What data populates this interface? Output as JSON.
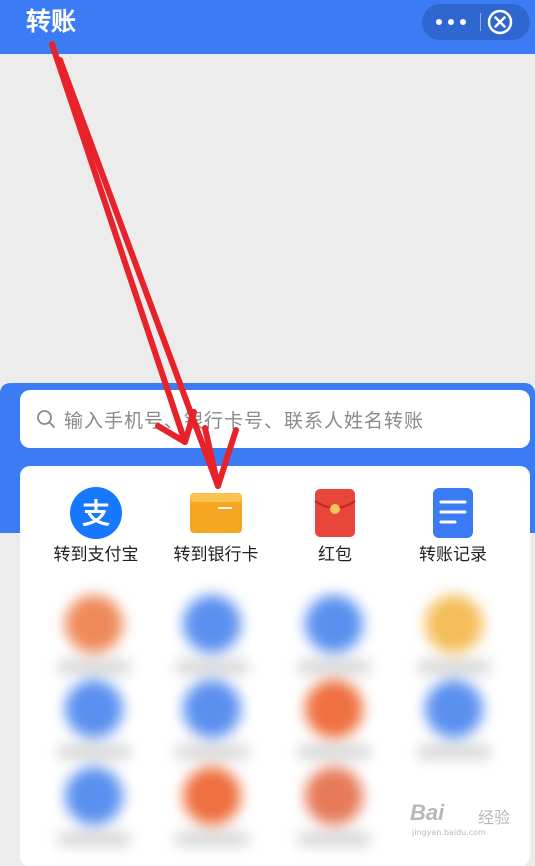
{
  "header": {
    "title": "转账",
    "more_icon": "more-dots-icon",
    "close_icon": "close-circle-icon"
  },
  "search": {
    "placeholder": "输入手机号、银行卡号、联系人姓名转账"
  },
  "features": [
    {
      "label": "转到支付宝",
      "icon": "alipay-icon",
      "color": "#1677ff"
    },
    {
      "label": "转到银行卡",
      "icon": "bank-card-icon",
      "color": "#f6a623"
    },
    {
      "label": "红包",
      "icon": "red-envelope-icon",
      "color": "#e8463a"
    },
    {
      "label": "转账记录",
      "icon": "record-icon",
      "color": "#3b7cf4"
    }
  ],
  "watermark": {
    "brand": "Bai",
    "name": "经验",
    "url": "jingyan.baidu.com"
  },
  "colors": {
    "header": "#3b7cf4",
    "annotation_arrow": "#e8222a"
  }
}
